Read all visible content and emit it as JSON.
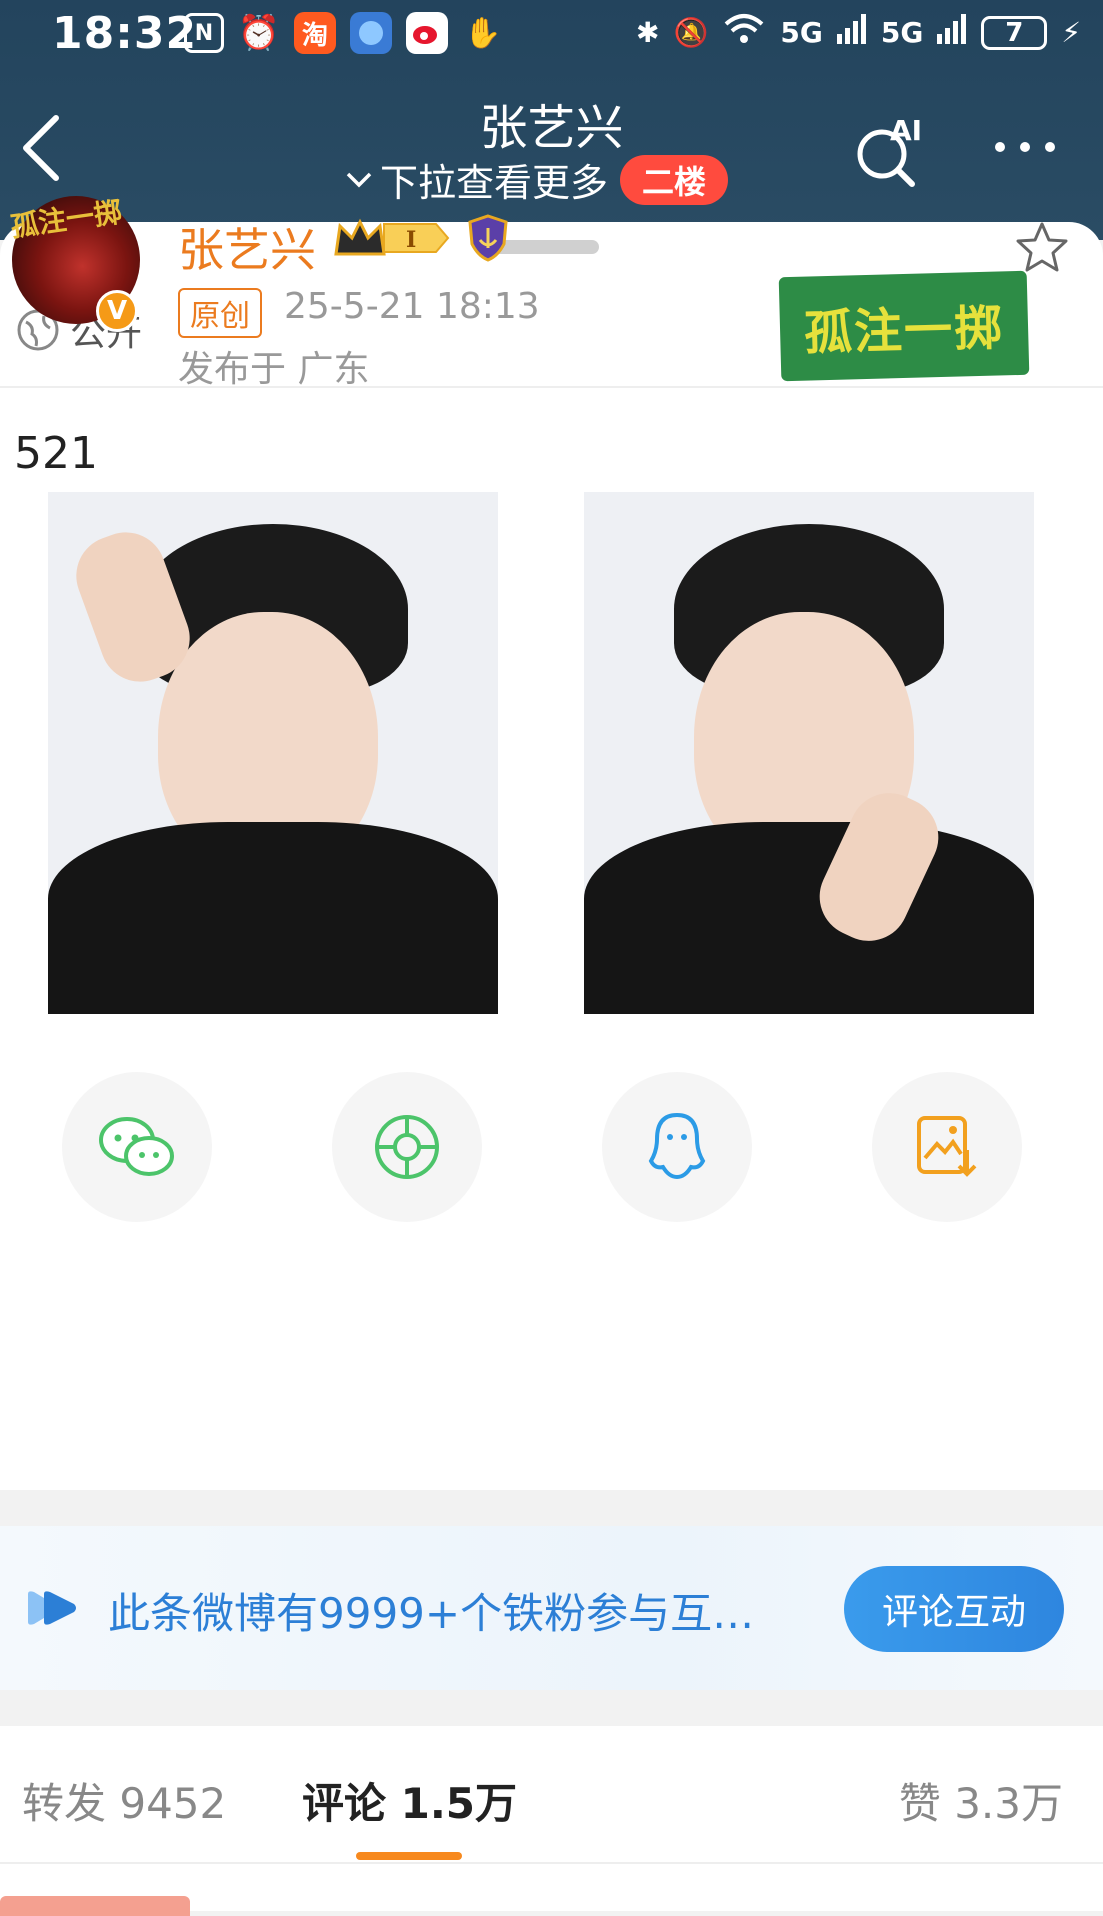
{
  "status_bar": {
    "time": "18:32",
    "network1": "5G",
    "network2": "5G",
    "battery": "7"
  },
  "nav": {
    "title": "张艺兴",
    "subtitle": "下拉查看更多",
    "floor_badge": "二楼",
    "ai_label": "AI"
  },
  "post": {
    "visibility": "公开",
    "banner_text": "孤注一掷",
    "author": "张艺兴",
    "avatar_text": "孤注一掷",
    "verified_mark": "V",
    "level_badge": "I",
    "original_tag": "原创",
    "timestamp": "25-5-21 18:13",
    "location": "发布于 广东",
    "text": "521",
    "images": [
      "photo-1",
      "photo-2"
    ]
  },
  "share": [
    {
      "name": "wechat-icon",
      "color": "#4cc46a"
    },
    {
      "name": "moments-icon",
      "color": "#4cc46a"
    },
    {
      "name": "qq-icon",
      "color": "#2b9be6"
    },
    {
      "name": "save-image-icon",
      "color": "#f2a01e"
    }
  ],
  "interaction": {
    "text": "此条微博有9999+个铁粉参与互…",
    "button": "评论互动"
  },
  "tabs": {
    "repost_label": "转发 9452",
    "comment_label": "评论 1.5万",
    "like_label": "赞 3.3万",
    "active": "comment"
  },
  "colors": {
    "nav_bg": "#23445d",
    "accent_orange": "#eb7b1f",
    "link_blue": "#2c7fd6",
    "floor_red": "#ff4b3e"
  }
}
